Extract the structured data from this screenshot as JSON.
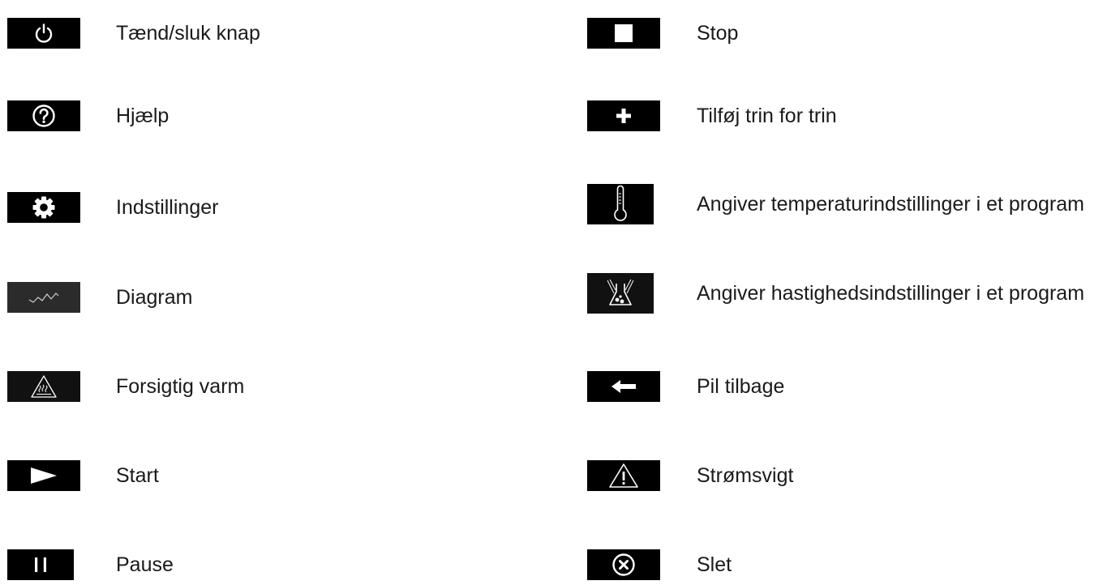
{
  "legend": {
    "left": [
      {
        "icon": "power-icon",
        "label": "Tænd/sluk knap"
      },
      {
        "icon": "help-icon",
        "label": "Hjælp"
      },
      {
        "icon": "gear-icon",
        "label": "Indstillinger"
      },
      {
        "icon": "chart-line-icon",
        "label": "Diagram"
      },
      {
        "icon": "hot-surface-warning-icon",
        "label": "Forsigtig varm"
      },
      {
        "icon": "play-icon",
        "label": "Start"
      },
      {
        "icon": "pause-icon",
        "label": "Pause"
      }
    ],
    "right": [
      {
        "icon": "stop-icon",
        "label": "Stop"
      },
      {
        "icon": "plus-icon",
        "label": "Tilføj trin for trin"
      },
      {
        "icon": "thermometer-icon",
        "label": "Angiver temperaturindstillinger i et program"
      },
      {
        "icon": "flask-speed-icon",
        "label": "Angiver hastighedsindstillinger i et program"
      },
      {
        "icon": "arrow-left-icon",
        "label": "Pil tilbage"
      },
      {
        "icon": "warning-icon",
        "label": "Strømsvigt"
      },
      {
        "icon": "delete-x-icon",
        "label": "Slet"
      }
    ]
  },
  "colors": {
    "icon_background": "#000000",
    "icon_foreground": "#ffffff",
    "text": "#1a1a1a"
  }
}
